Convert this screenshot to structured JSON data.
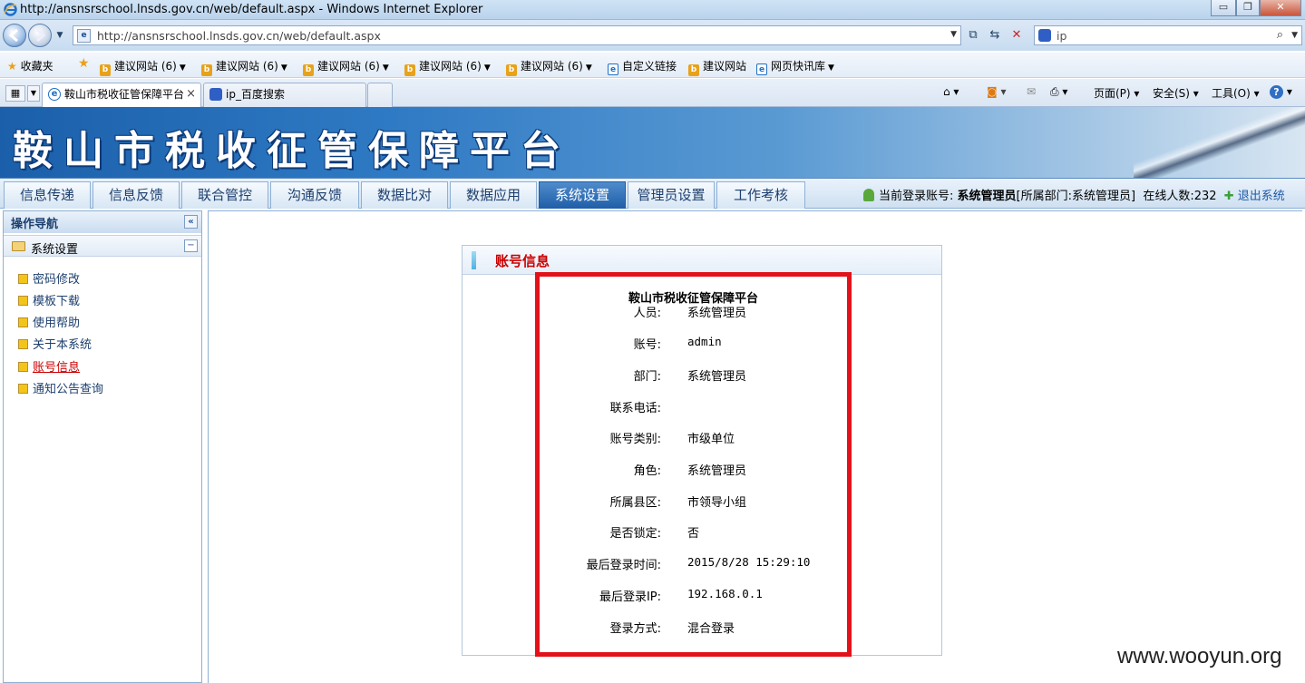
{
  "window": {
    "title": "http://ansnsrschool.lnsds.gov.cn/web/default.aspx - Windows Internet Explorer",
    "minimize": "▭",
    "restore": "❐",
    "close": "✕"
  },
  "address": {
    "url": "http://ansnsrschool.lnsds.gov.cn/web/default.aspx",
    "search_value": "ip"
  },
  "favorites": {
    "label": "收藏夹",
    "items": [
      "建议网站 (6)",
      "建议网站 (6)",
      "建议网站 (6)",
      "建议网站 (6)",
      "建议网站 (6)",
      "自定义链接",
      "建议网站",
      "网页快讯库"
    ]
  },
  "browser_tabs": [
    {
      "label": "鞍山市税收征管保障平台",
      "close": "×"
    },
    {
      "label": "ip_百度搜索"
    }
  ],
  "command_bar": {
    "page": "页面(P)",
    "safety": "安全(S)",
    "tools": "工具(O)"
  },
  "app": {
    "logo_text": "鞍山市税收征管保障平台",
    "nav": [
      "信息传递",
      "信息反馈",
      "联合管控",
      "沟通反馈",
      "数据比对",
      "数据应用",
      "系统设置",
      "管理员设置",
      "工作考核"
    ],
    "active_nav": "系统设置",
    "user_prefix": "当前登录账号:",
    "user_name": "系统管理员",
    "user_dept": "[所属部门:系统管理员]",
    "online_label": "在线人数:232",
    "logout": "退出系统"
  },
  "sidebar": {
    "title": "操作导航",
    "collapse": "«",
    "group": "系统设置",
    "group_toggle": "−",
    "items": [
      "密码修改",
      "模板下载",
      "使用帮助",
      "关于本系统",
      "账号信息",
      "通知公告查询"
    ],
    "active_item": "账号信息"
  },
  "panel": {
    "title": "账号信息",
    "system_name": "鞍山市税收征管保障平台",
    "fields": [
      {
        "label": "人员:",
        "value": "系统管理员"
      },
      {
        "label": "账号:",
        "value": "admin"
      },
      {
        "label": "部门:",
        "value": "系统管理员"
      },
      {
        "label": "联系电话:",
        "value": ""
      },
      {
        "label": "账号类别:",
        "value": "市级单位"
      },
      {
        "label": "角色:",
        "value": "系统管理员"
      },
      {
        "label": "所属县区:",
        "value": "市领导小组"
      },
      {
        "label": "是否锁定:",
        "value": "否"
      },
      {
        "label": "最后登录时间:",
        "value": "2015/8/28 15:29:10"
      },
      {
        "label": "最后登录IP:",
        "value": "192.168.0.1"
      },
      {
        "label": "登录方式:",
        "value": "混合登录"
      }
    ]
  },
  "watermark": "www.wooyun.org"
}
